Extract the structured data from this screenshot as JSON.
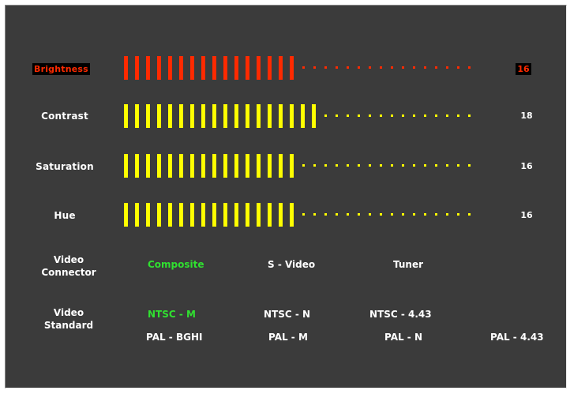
{
  "colors": {
    "background": "#3b3b3b",
    "selected_bar": "#ff2a00",
    "normal_bar": "#ffff00",
    "active_option": "#30e030",
    "text": "#ffffff"
  },
  "max_level": 32,
  "controls": [
    {
      "label": "Brightness",
      "value": "16",
      "level": 16,
      "selected": true
    },
    {
      "label": "Contrast",
      "value": "18",
      "level": 18,
      "selected": false
    },
    {
      "label": "Saturation",
      "value": "16",
      "level": 16,
      "selected": false
    },
    {
      "label": "Hue",
      "value": "16",
      "level": 16,
      "selected": false
    }
  ],
  "video_connector": {
    "label_line1": "Video",
    "label_line2": "Connector",
    "options": [
      "Composite",
      "S - Video",
      "Tuner"
    ],
    "active": "Composite"
  },
  "video_standard": {
    "label_line1": "Video",
    "label_line2": "Standard",
    "options_row1": [
      "NTSC - M",
      "NTSC - N",
      "NTSC - 4.43"
    ],
    "options_row2": [
      "PAL - BGHI",
      "PAL - M",
      "PAL - N",
      "PAL - 4.43"
    ],
    "active": "NTSC - M"
  }
}
